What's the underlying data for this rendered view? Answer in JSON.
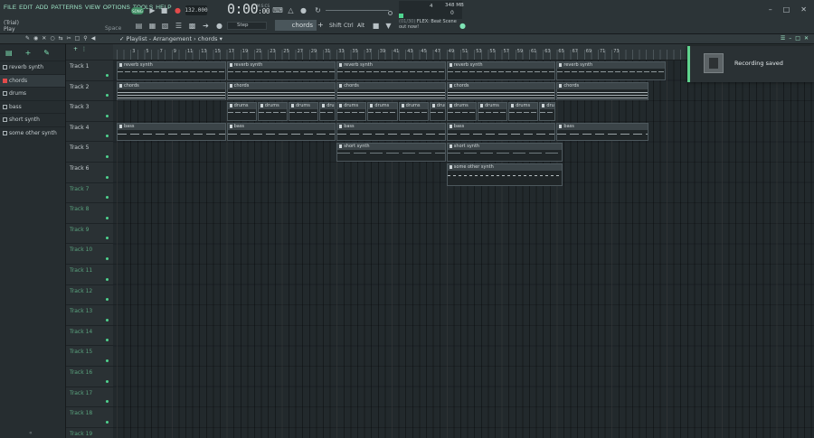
{
  "menu": [
    "FILE",
    "EDIT",
    "ADD",
    "PATTERNS",
    "VIEW",
    "OPTIONS",
    "TOOLS",
    "HELP"
  ],
  "hint": {
    "mode": "(Trial)",
    "action": "Play",
    "key": "Space"
  },
  "transport": {
    "mode": "SONG",
    "tempo": "132.000",
    "time": "0:00",
    "time_sub": ":00",
    "time_unit": "M:S:CS"
  },
  "perf": {
    "cpu": "4",
    "memory": "348 MB",
    "polyphony": "0"
  },
  "snap": "Step",
  "pattern": "chords",
  "modifier_keys": [
    "Shift",
    "Ctrl",
    "Alt"
  ],
  "news": {
    "count": "(01/30)",
    "text": "FLEX: Beat Scene",
    "link": "out now!"
  },
  "playlist": {
    "title": "Playlist - Arrangement › chords"
  },
  "picker": {
    "items": [
      {
        "label": "reverb synth",
        "selected": false,
        "red": false
      },
      {
        "label": "chords",
        "selected": true,
        "red": true
      },
      {
        "label": "drums",
        "selected": false,
        "red": false
      },
      {
        "label": "bass",
        "selected": false,
        "red": false
      },
      {
        "label": "short synth",
        "selected": false,
        "red": false
      },
      {
        "label": "some other synth",
        "selected": false,
        "red": false
      }
    ]
  },
  "tracks": [
    {
      "name": "Track 1",
      "active": true
    },
    {
      "name": "Track 2",
      "active": true
    },
    {
      "name": "Track 3",
      "active": true
    },
    {
      "name": "Track 4",
      "active": true
    },
    {
      "name": "Track 5",
      "active": true
    },
    {
      "name": "Track 6",
      "active": true
    },
    {
      "name": "Track 7",
      "active": false
    },
    {
      "name": "Track 8",
      "active": false
    },
    {
      "name": "Track 9",
      "active": false
    },
    {
      "name": "Track 10",
      "active": false
    },
    {
      "name": "Track 11",
      "active": false
    },
    {
      "name": "Track 12",
      "active": false
    },
    {
      "name": "Track 13",
      "active": false
    },
    {
      "name": "Track 14",
      "active": false
    },
    {
      "name": "Track 15",
      "active": false
    },
    {
      "name": "Track 16",
      "active": false
    },
    {
      "name": "Track 17",
      "active": false
    },
    {
      "name": "Track 18",
      "active": false
    },
    {
      "name": "Track 19",
      "active": false
    }
  ],
  "ruler": [
    "3",
    "5",
    "7",
    "9",
    "11",
    "13",
    "15",
    "17",
    "19",
    "21",
    "23",
    "25",
    "27",
    "29",
    "31",
    "33",
    "35",
    "37",
    "39",
    "41",
    "43",
    "45",
    "47",
    "49",
    "51",
    "53",
    "55",
    "57",
    "59",
    "61",
    "63",
    "65",
    "67",
    "69",
    "71",
    "73"
  ],
  "clips": [
    {
      "track": 0,
      "start": 1,
      "len": 16,
      "label": "reverb synth",
      "kind": "notes"
    },
    {
      "track": 0,
      "start": 17,
      "len": 16,
      "label": "reverb synth",
      "kind": "notes"
    },
    {
      "track": 0,
      "start": 33,
      "len": 16,
      "label": "reverb synth",
      "kind": "notes"
    },
    {
      "track": 0,
      "start": 49,
      "len": 16,
      "label": "reverb synth",
      "kind": "notes"
    },
    {
      "track": 0,
      "start": 65,
      "len": 16,
      "label": "reverb synth",
      "kind": "notes"
    },
    {
      "track": 1,
      "start": 1,
      "len": 16,
      "label": "chords",
      "kind": "chords"
    },
    {
      "track": 1,
      "start": 17,
      "len": 16,
      "label": "chords",
      "kind": "chords"
    },
    {
      "track": 1,
      "start": 33,
      "len": 16,
      "label": "chords",
      "kind": "chords"
    },
    {
      "track": 1,
      "start": 49,
      "len": 16,
      "label": "chords",
      "kind": "chords"
    },
    {
      "track": 1,
      "start": 65,
      "len": 13.5,
      "label": "chords",
      "kind": "chords"
    },
    {
      "track": 2,
      "start": 17,
      "len": 4.5,
      "label": "drums",
      "kind": "notes"
    },
    {
      "track": 2,
      "start": 21.5,
      "len": 4.5,
      "label": "drums",
      "kind": "notes"
    },
    {
      "track": 2,
      "start": 26,
      "len": 4.5,
      "label": "drums",
      "kind": "notes"
    },
    {
      "track": 2,
      "start": 30.5,
      "len": 2.5,
      "label": "drums",
      "kind": "notes"
    },
    {
      "track": 2,
      "start": 33,
      "len": 4.5,
      "label": "drums",
      "kind": "notes"
    },
    {
      "track": 2,
      "start": 37.5,
      "len": 4.5,
      "label": "drums",
      "kind": "notes"
    },
    {
      "track": 2,
      "start": 42,
      "len": 4.5,
      "label": "drums",
      "kind": "notes"
    },
    {
      "track": 2,
      "start": 46.5,
      "len": 2.5,
      "label": "drums",
      "kind": "notes"
    },
    {
      "track": 2,
      "start": 49,
      "len": 4.5,
      "label": "drums",
      "kind": "notes"
    },
    {
      "track": 2,
      "start": 53.5,
      "len": 4.5,
      "label": "drums",
      "kind": "notes"
    },
    {
      "track": 2,
      "start": 58,
      "len": 4.5,
      "label": "drums",
      "kind": "notes"
    },
    {
      "track": 2,
      "start": 62.5,
      "len": 2.5,
      "label": "drums",
      "kind": "notes"
    },
    {
      "track": 3,
      "start": 1,
      "len": 16,
      "label": "bass",
      "kind": "bass"
    },
    {
      "track": 3,
      "start": 17,
      "len": 16,
      "label": "bass",
      "kind": "bass"
    },
    {
      "track": 3,
      "start": 33,
      "len": 16,
      "label": "bass",
      "kind": "bass"
    },
    {
      "track": 3,
      "start": 49,
      "len": 16,
      "label": "bass",
      "kind": "bass"
    },
    {
      "track": 3,
      "start": 65,
      "len": 13.5,
      "label": "bass",
      "kind": "bass"
    },
    {
      "track": 4,
      "start": 33,
      "len": 16,
      "label": "short synth",
      "kind": "short"
    },
    {
      "track": 4,
      "start": 49,
      "len": 17,
      "label": "short synth",
      "kind": "short"
    },
    {
      "track": 5,
      "start": 49,
      "len": 17,
      "label": "some other synth",
      "kind": "other"
    }
  ],
  "toast": {
    "text": "Recording saved"
  }
}
